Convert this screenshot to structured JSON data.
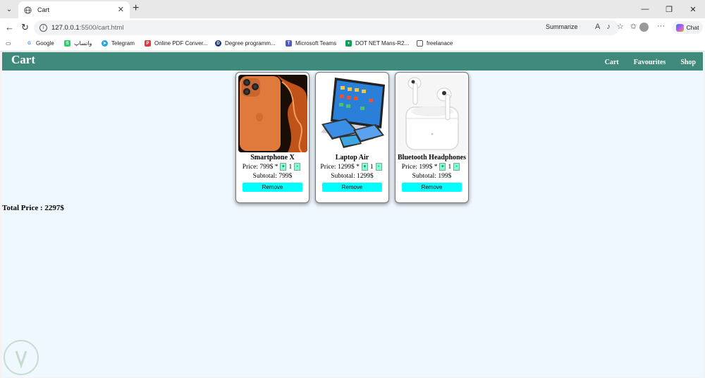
{
  "browser": {
    "tab_title": "Cart",
    "url_host": "127.0.0.1",
    "url_path": ":5500/cart.html",
    "summarize_label": "Summarize",
    "chat_label": "Chat",
    "bookmarks": [
      {
        "label": "Google",
        "color": "#4285f4",
        "glyph": "G"
      },
      {
        "label": "واتساپ",
        "color": "#25d366",
        "glyph": "S"
      },
      {
        "label": "Telegram",
        "color": "#2aa1da",
        "glyph": "✈"
      },
      {
        "label": "Online PDF Conver...",
        "color": "#e53935",
        "glyph": "P"
      },
      {
        "label": "Degree programm...",
        "color": "#1a3a7a",
        "glyph": "D"
      },
      {
        "label": "Microsoft Teams",
        "color": "#5059c9",
        "glyph": "T"
      },
      {
        "label": "DOT NET Mans-R2...",
        "color": "#0f9d58",
        "glyph": "+"
      },
      {
        "label": "freelanace",
        "color": "#666666",
        "glyph": "▭"
      }
    ]
  },
  "site": {
    "title": "Cart",
    "nav": [
      "Cart",
      "Favourites",
      "Shop"
    ],
    "header_color": "#3f8a7a"
  },
  "cart": {
    "items": [
      {
        "name": "Smartphone X",
        "price": "Price: 799$ *",
        "qty": "1",
        "subtotal": "Subtotal: 799$",
        "image": "orange-smartphone"
      },
      {
        "name": "Laptop Air",
        "price": "Price: 1299$ *",
        "qty": "1",
        "subtotal": "Subtotal: 1299$",
        "image": "laptop-and-tablets"
      },
      {
        "name": "Bluetooth Headphones",
        "price": "Price: 199$ *",
        "qty": "1",
        "subtotal": "Subtotal: 199$",
        "image": "white-earbuds"
      }
    ],
    "plus_label": "+",
    "minus_label": "-",
    "remove_label": "Remove",
    "total": "Total Price : 2297$"
  }
}
